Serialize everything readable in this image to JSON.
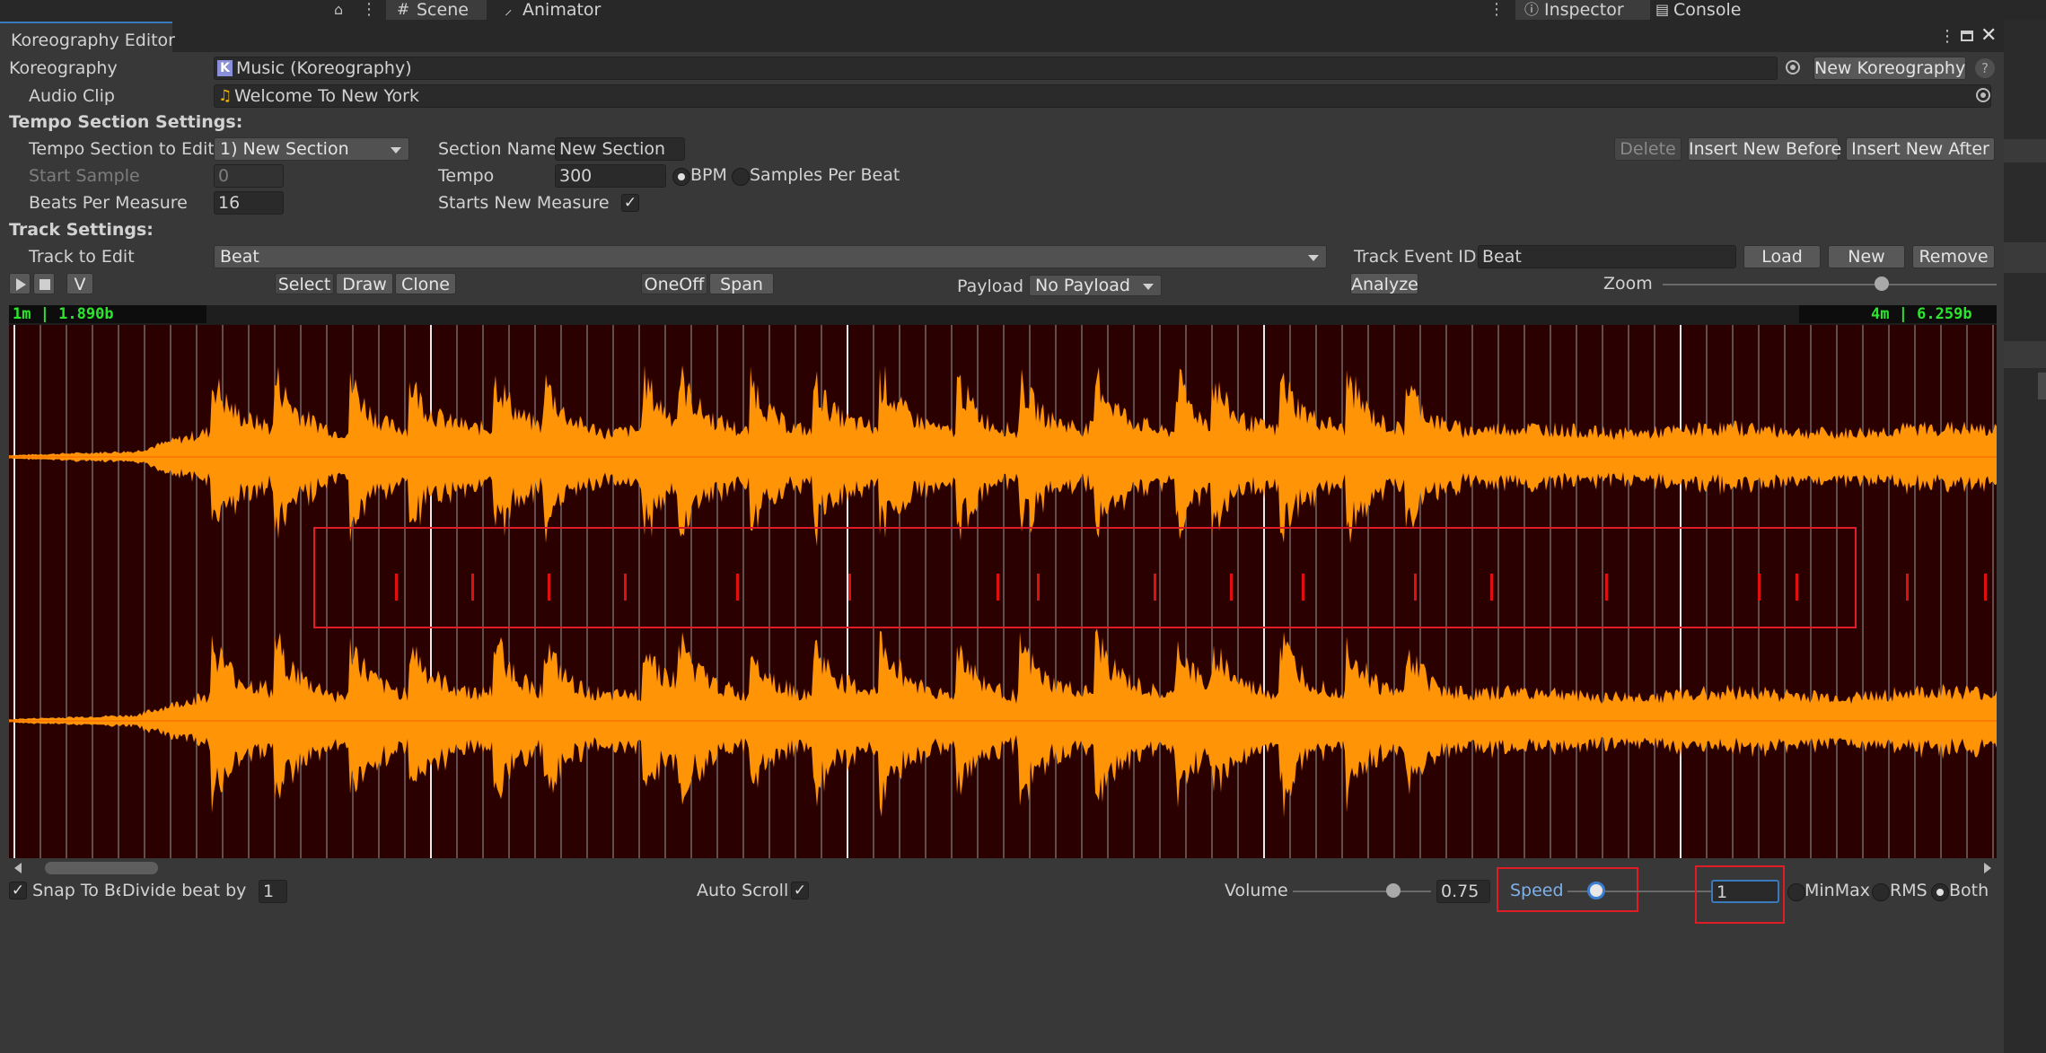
{
  "top_bar": {
    "scene_tab": "Scene",
    "animator_tab": "Animator",
    "inspector_tab": "Inspector",
    "console_tab": "Console"
  },
  "window": {
    "title": "Koreography Editor"
  },
  "koreography": {
    "label": "Koreography",
    "value": "Music (Koreography)",
    "new_button": "New Koreography",
    "help": "?"
  },
  "audio_clip": {
    "label": "Audio Clip",
    "value": "Welcome To New York"
  },
  "tempo": {
    "header": "Tempo Section Settings:",
    "section_label": "Tempo Section to Edit",
    "section_value": "1) New Section",
    "start_sample_label": "Start Sample",
    "start_sample_value": "0",
    "beats_label": "Beats Per Measure",
    "beats_value": "16",
    "section_name_label": "Section Name",
    "section_name_value": "New Section",
    "tempo_label": "Tempo",
    "tempo_value": "300",
    "bpm_label": "BPM",
    "spb_label": "Samples Per Beat",
    "starts_measure_label": "Starts New Measure",
    "delete_button": "Delete",
    "insert_before_button": "Insert New Before",
    "insert_after_button": "Insert New After"
  },
  "track": {
    "header": "Track Settings:",
    "track_label": "Track to Edit",
    "track_value": "Beat",
    "event_id_label": "Track Event ID",
    "event_id_value": "Beat",
    "load_button": "Load",
    "new_button": "New",
    "remove_button": "Remove"
  },
  "toolbar": {
    "v_button": "V",
    "select": "Select",
    "draw": "Draw",
    "clone": "Clone",
    "oneoff": "OneOff",
    "span": "Span",
    "payload_label": "Payload",
    "payload_value": "No Payload",
    "analyze": "Analyze",
    "zoom_label": "Zoom",
    "zoom_level": 0.84
  },
  "waveform": {
    "left_time": "1m | 1.890b",
    "right_time": "4m | 6.259b",
    "background": "#2a0000",
    "wave_color": "#ff9406",
    "wave_dark": "#ff7a00",
    "event_color": "#e01010"
  },
  "bottom": {
    "snap_label": "Snap To Bea",
    "divide_label": "Divide beat by",
    "divide_value": "1",
    "auto_scroll_label": "Auto Scroll",
    "volume_label": "Volume",
    "volume_value": "0.75",
    "speed_label": "Speed",
    "speed_value": "1",
    "minmax_label": "MinMax",
    "rms_label": "RMS",
    "both_label": "Both"
  }
}
